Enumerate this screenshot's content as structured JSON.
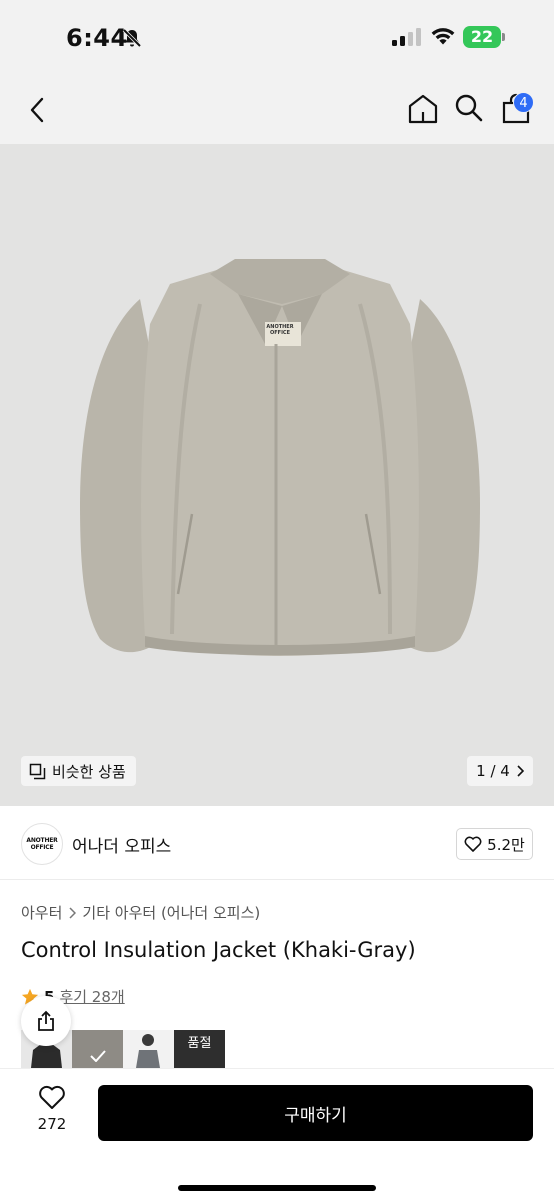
{
  "status_bar": {
    "time": "6:44",
    "battery": "22"
  },
  "nav": {
    "cart_count": "4"
  },
  "gallery": {
    "similar_label": "비슷한 상품",
    "pager": "1 / 4"
  },
  "jacket_label": [
    "ANOTHER",
    "OFFICE"
  ],
  "brand": {
    "logo_lines": [
      "ANOTHER",
      "OFFICE"
    ],
    "name": "어나더 오피스",
    "likes": "5.2만"
  },
  "breadcrumb": {
    "category": "아우터",
    "subcategory": "기타 아우터 (어나더 오피스)"
  },
  "product": {
    "title": "Control Insulation Jacket (Khaki-Gray)",
    "rating": "5",
    "reviews": "후기 28개"
  },
  "thumbs": {
    "soldout_label": "품절"
  },
  "bottom": {
    "wish_count": "272",
    "buy_label": "구매하기"
  },
  "colors": {
    "accent_badge": "#2f6cf6",
    "battery": "#34c759",
    "star": "#f5a623",
    "buy_button": "#000000"
  }
}
